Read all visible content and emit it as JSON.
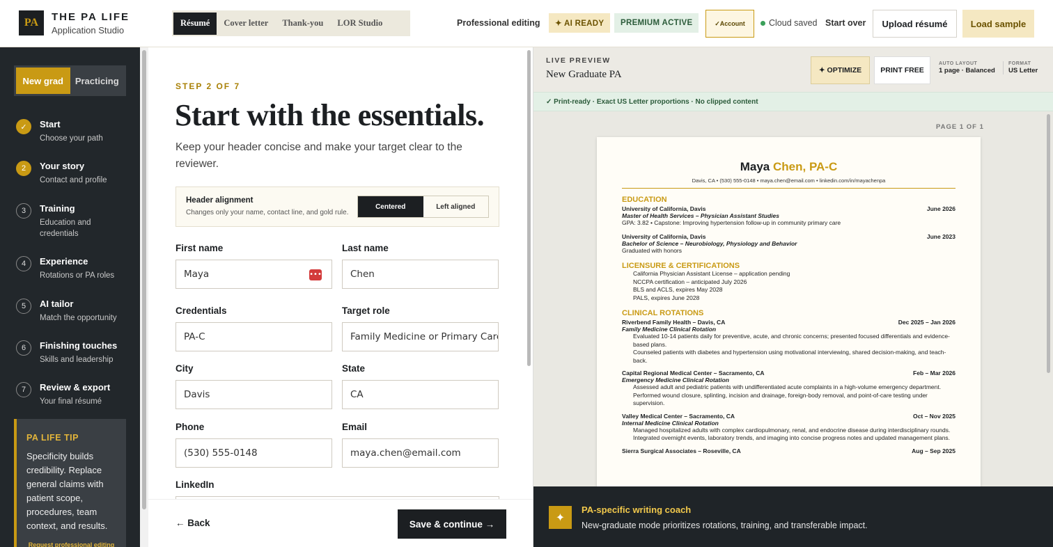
{
  "brand": {
    "logo": "PA",
    "title": "THE PA LIFE",
    "subtitle": "Application Studio"
  },
  "doc_tabs": [
    {
      "label": "Résumé",
      "active": true
    },
    {
      "label": "Cover letter",
      "active": false
    },
    {
      "label": "Thank-you",
      "active": false
    },
    {
      "label": "LOR Studio",
      "active": false
    }
  ],
  "top_right": {
    "professional_editing": "Professional editing",
    "ai_ready": "✦ AI READY",
    "premium_active": "PREMIUM ACTIVE",
    "account": "✓Account",
    "cloud_saved": "Cloud saved",
    "start_over": "Start over",
    "upload": "Upload résumé",
    "load_sample": "Load sample"
  },
  "mode_toggle": {
    "new_grad": "New grad",
    "practicing": "Practicing",
    "selected": "New grad"
  },
  "steps": [
    {
      "num": "✓",
      "title": "Start",
      "sub": "Choose your path",
      "state": "done"
    },
    {
      "num": "2",
      "title": "Your story",
      "sub": "Contact and profile",
      "state": "current"
    },
    {
      "num": "3",
      "title": "Training",
      "sub": "Education and credentials",
      "state": "todo"
    },
    {
      "num": "4",
      "title": "Experience",
      "sub": "Rotations or PA roles",
      "state": "todo"
    },
    {
      "num": "5",
      "title": "AI tailor",
      "sub": "Match the opportunity",
      "state": "todo"
    },
    {
      "num": "6",
      "title": "Finishing touches",
      "sub": "Skills and leadership",
      "state": "todo"
    },
    {
      "num": "7",
      "title": "Review & export",
      "sub": "Your final résumé",
      "state": "todo"
    }
  ],
  "tip": {
    "heading": "PA LIFE TIP",
    "body": "Specificity builds credibility. Replace general claims with patient scope, procedures, team context, and results.",
    "link": "Request professional editing"
  },
  "form": {
    "step": "STEP 2 OF 7",
    "heading": "Start with the essentials.",
    "intro": "Keep your header concise and make your target clear to the reviewer.",
    "alignment": {
      "title": "Header alignment",
      "sub": "Changes only your name, contact line, and gold rule.",
      "centered": "Centered",
      "left": "Left aligned",
      "selected": "Centered"
    },
    "fields": {
      "first_name": {
        "label": "First name",
        "value": "Maya"
      },
      "last_name": {
        "label": "Last name",
        "value": "Chen"
      },
      "credentials": {
        "label": "Credentials",
        "value": "PA-C"
      },
      "target_role": {
        "label": "Target role",
        "value": "Family Medicine or Primary Care"
      },
      "city": {
        "label": "City",
        "value": "Davis"
      },
      "state": {
        "label": "State",
        "value": "CA"
      },
      "phone": {
        "label": "Phone",
        "value": "(530) 555-0148"
      },
      "email": {
        "label": "Email",
        "value": "maya.chen@email.com"
      },
      "linkedin": {
        "label": "LinkedIn",
        "value": ""
      }
    },
    "back": "← Back",
    "save": "Save & continue →"
  },
  "preview": {
    "label": "LIVE PREVIEW",
    "title": "New Graduate PA",
    "optimize": "✦ OPTIMIZE",
    "print": "PRINT FREE",
    "auto_layout_label": "AUTO LAYOUT",
    "auto_layout_value": "1 page · Balanced",
    "format_label": "FORMAT",
    "format_value": "US Letter",
    "ready": "✓ Print-ready · Exact US Letter proportions · No clipped content",
    "page": "PAGE 1 OF 1",
    "resume": {
      "first": "Maya",
      "last_cred": "Chen, PA-C",
      "contact": "Davis, CA • (530) 555-0148 • maya.chen@email.com • linkedin.com/in/mayachenpa",
      "education": "EDUCATION",
      "edu1_school": "University of California, Davis",
      "edu1_date": "June 2026",
      "edu1_degree": "Master of Health Services – Physician Assistant Studies",
      "edu1_note": "GPA: 3.82 • Capstone: Improving hypertension follow-up in community primary care",
      "edu2_school": "University of California, Davis",
      "edu2_date": "June 2023",
      "edu2_degree": "Bachelor of Science – Neurobiology, Physiology and Behavior",
      "edu2_note": "Graduated with honors",
      "licensure": "LICENSURE & CERTIFICATIONS",
      "lic": [
        "California Physician Assistant License – application pending",
        "NCCPA certification – anticipated July 2026",
        "BLS and ACLS, expires May 2028",
        "PALS, expires June 2028"
      ],
      "clinical": "CLINICAL ROTATIONS",
      "rotations": [
        {
          "site": "Riverbend Family Health – Davis, CA",
          "date": "Dec 2025 – Jan 2026",
          "title": "Family Medicine Clinical Rotation",
          "bullets": [
            "Evaluated 10-14 patients daily for preventive, acute, and chronic concerns; presented focused differentials and evidence-based plans.",
            "Counseled patients with diabetes and hypertension using motivational interviewing, shared decision-making, and teach-back."
          ]
        },
        {
          "site": "Capital Regional Medical Center – Sacramento, CA",
          "date": "Feb – Mar 2026",
          "title": "Emergency Medicine Clinical Rotation",
          "bullets": [
            "Assessed adult and pediatric patients with undifferentiated acute complaints in a high-volume emergency department.",
            "Performed wound closure, splinting, incision and drainage, foreign-body removal, and point-of-care testing under supervision."
          ]
        },
        {
          "site": "Valley Medical Center – Sacramento, CA",
          "date": "Oct – Nov 2025",
          "title": "Internal Medicine Clinical Rotation",
          "bullets": [
            "Managed hospitalized adults with complex cardiopulmonary, renal, and endocrine disease during interdisciplinary rounds.",
            "Integrated overnight events, laboratory trends, and imaging into concise progress notes and updated management plans."
          ]
        },
        {
          "site": "Sierra Surgical Associates – Roseville, CA",
          "date": "Aug – Sep 2025",
          "title": "",
          "bullets": []
        }
      ]
    }
  },
  "coach": {
    "title": "PA-specific writing coach",
    "sub": "New-graduate mode prioritizes rotations, training, and transferable impact."
  },
  "colors": {
    "gold": "#c99a14",
    "dark": "#1c1f22",
    "green": "#2b5b3a"
  }
}
